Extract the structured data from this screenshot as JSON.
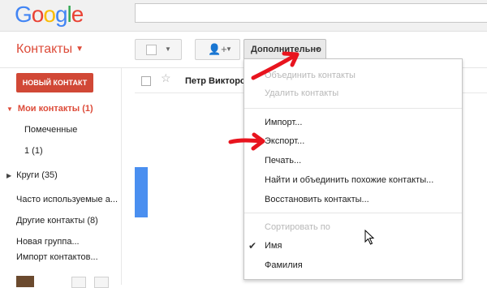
{
  "header": {
    "logo_letters": [
      {
        "ch": "G",
        "color": "#4285f4"
      },
      {
        "ch": "o",
        "color": "#ea4335"
      },
      {
        "ch": "o",
        "color": "#fbbc05"
      },
      {
        "ch": "g",
        "color": "#4285f4"
      },
      {
        "ch": "l",
        "color": "#34a853"
      },
      {
        "ch": "e",
        "color": "#ea4335"
      }
    ],
    "search_value": ""
  },
  "app": {
    "title": "Контакты",
    "title_caret": "▼"
  },
  "toolbar": {
    "more_label": "Дополнительно",
    "dropdown_glyph": "▼",
    "add_group_glyph": "👤+"
  },
  "sidebar": {
    "new_contact": "НОВЫЙ КОНТАКТ",
    "my_contacts": "Мои контакты (1)",
    "expanded_glyph": "▼",
    "collapsed_glyph": "▶",
    "starred": "Помеченные",
    "one": "1 (1)",
    "circles": "Круги (35)",
    "frequent": "Часто используемые а...",
    "other": "Другие контакты (8)",
    "new_group": "Новая группа...",
    "import": "Импорт контактов..."
  },
  "list": {
    "row_name": "Петр Викторо",
    "star_glyph": "☆"
  },
  "menu": {
    "merge": "Объединить контакты",
    "delete": "Удалить контакты",
    "import": "Импорт...",
    "export": "Экспорт...",
    "print": "Печать...",
    "find_merge": "Найти и объединить похожие контакты...",
    "restore": "Восстановить контакты...",
    "sort_by": "Сортировать по",
    "sort_name": "Имя",
    "sort_surname": "Фамилия",
    "check_glyph": "✔"
  },
  "colors": {
    "brand_red": "#dd4b39",
    "button_red": "#d14836",
    "accent_blue": "#4a8ff0",
    "annotation_red": "#e8141e"
  }
}
